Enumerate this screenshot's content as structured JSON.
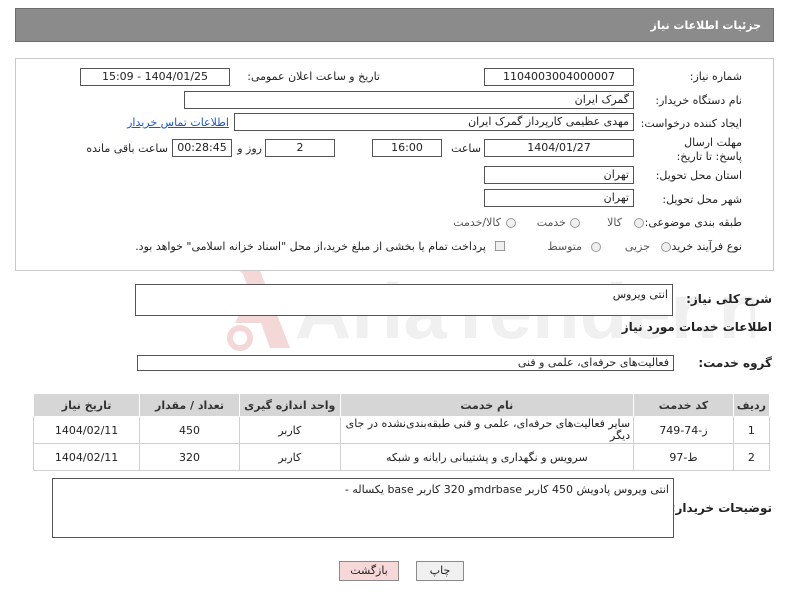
{
  "header": {
    "title": "جزئیات اطلاعات نیاز"
  },
  "fields": {
    "need_number_label": "شماره نیاز:",
    "need_number": "1104003004000007",
    "announce_label": "تاریخ و ساعت اعلان عمومی:",
    "announce_value": "1404/01/25 - 15:09",
    "buyer_org_label": "نام دستگاه خریدار:",
    "buyer_org": "گمرک ایران",
    "creator_label": "ایجاد کننده درخواست:",
    "creator": "مهدی عظیمی کارپرداز گمرک ایران",
    "contact_link": "اطلاعات تماس خریدار",
    "deadline_label": "مهلت ارسال پاسخ: تا تاریخ:",
    "deadline_date": "1404/01/27",
    "time_label": "ساعت",
    "deadline_time": "16:00",
    "days_value": "2",
    "days_label": "روز و",
    "remaining_time": "00:28:45",
    "remaining_label": "ساعت باقی مانده",
    "province_label": "استان محل تحویل:",
    "province": "تهران",
    "city_label": "شهر محل تحویل:",
    "city": "تهران",
    "category_label": "طبقه بندی موضوعی:",
    "category_options": [
      "کالا",
      "خدمت",
      "کالا/خدمت"
    ],
    "process_label": "نوع فرآیند خرید :",
    "process_options": [
      "جزیی",
      "متوسط"
    ],
    "payment_note": "پرداخت تمام یا بخشی از مبلغ خرید،از محل \"اسناد خزانه اسلامی\" خواهد بود."
  },
  "description": {
    "label": "شرح کلی نیاز:",
    "value": "انتی ویروس"
  },
  "services_section": {
    "title": "اطلاعات خدمات مورد نیاز",
    "group_label": "گروه خدمت:",
    "group_value": "فعالیت‌های حرفه‌ای، علمی و فنی"
  },
  "table": {
    "headers": [
      "ردیف",
      "کد خدمت",
      "نام خدمت",
      "واحد اندازه گیری",
      "تعداد / مقدار",
      "تاریخ نیاز"
    ],
    "rows": [
      [
        "1",
        "ز-74-749",
        "سایر فعالیت‌های حرفه‌ای، علمی و فنی طبقه‌بندی‌نشده در جای دیگر",
        "کاربر",
        "450",
        "1404/02/11"
      ],
      [
        "2",
        "ط-97",
        "سرویس و نگهداری و پشتیبانی رایانه و شبکه",
        "کاربر",
        "320",
        "1404/02/11"
      ]
    ]
  },
  "buyer_notes": {
    "label": "توضیحات خریدار:",
    "value": "انتی ویروس پادویش 450 کاربر mdrbaseو 320 کاربر base یکساله -"
  },
  "buttons": {
    "print": "چاپ",
    "back": "بازگشت"
  },
  "watermark": {
    "text": "AriaTender.neT"
  },
  "colors": {
    "header_bg": "#8b8b8b",
    "link": "#1b56c4",
    "back_btn_bg": "#f6d8d8",
    "print_btn_bg": "#f0f0f0"
  }
}
